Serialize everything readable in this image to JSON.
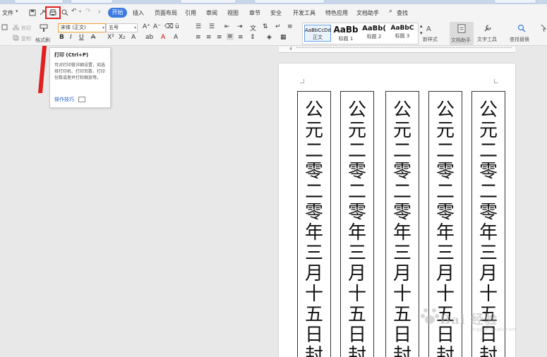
{
  "menu": {
    "file": "文件",
    "start": "开始",
    "tabs": [
      "插入",
      "页面布局",
      "引用",
      "审阅",
      "视图",
      "章节",
      "安全",
      "开发工具",
      "特色应用",
      "文档助手"
    ],
    "search": "查找"
  },
  "ribbon": {
    "cut": "剪切",
    "copy": "复制",
    "format_painter": "格式刷",
    "font_name": "宋体 (正文)",
    "font_size": "五号",
    "styles": [
      {
        "sample": "AaBbCcDd",
        "name": "正文"
      },
      {
        "sample": "AaBb",
        "name": "标题 1"
      },
      {
        "sample": "AaBb(",
        "name": "标题 2"
      },
      {
        "sample": "AaBbC",
        "name": "标题 3"
      }
    ],
    "new_style": "新样式",
    "doc_assistant": "文档助手",
    "text_tools": "文字工具",
    "find_replace": "查找替换"
  },
  "ruler_mark": "4",
  "tooltip": {
    "title": "打印 (Ctrl+P)",
    "description": "可对打印做详细设置，如选择打印机、打印页数、打印份数或者并打和缩放等。",
    "link": "操作技巧"
  },
  "document": {
    "columns": [
      "公元二零二零年三月十五日封",
      "公元二零二零年三月十五日封",
      "公元二零二零年三月十五日封",
      "公元二零二零年三月十五日封",
      "公元二零二零年三月十五日封"
    ]
  },
  "watermark": {
    "text": "Bai 经验",
    "url": "jingyan.baidu.com"
  },
  "colors": {
    "accent": "#3d7be0",
    "highlight": "#e02020"
  }
}
